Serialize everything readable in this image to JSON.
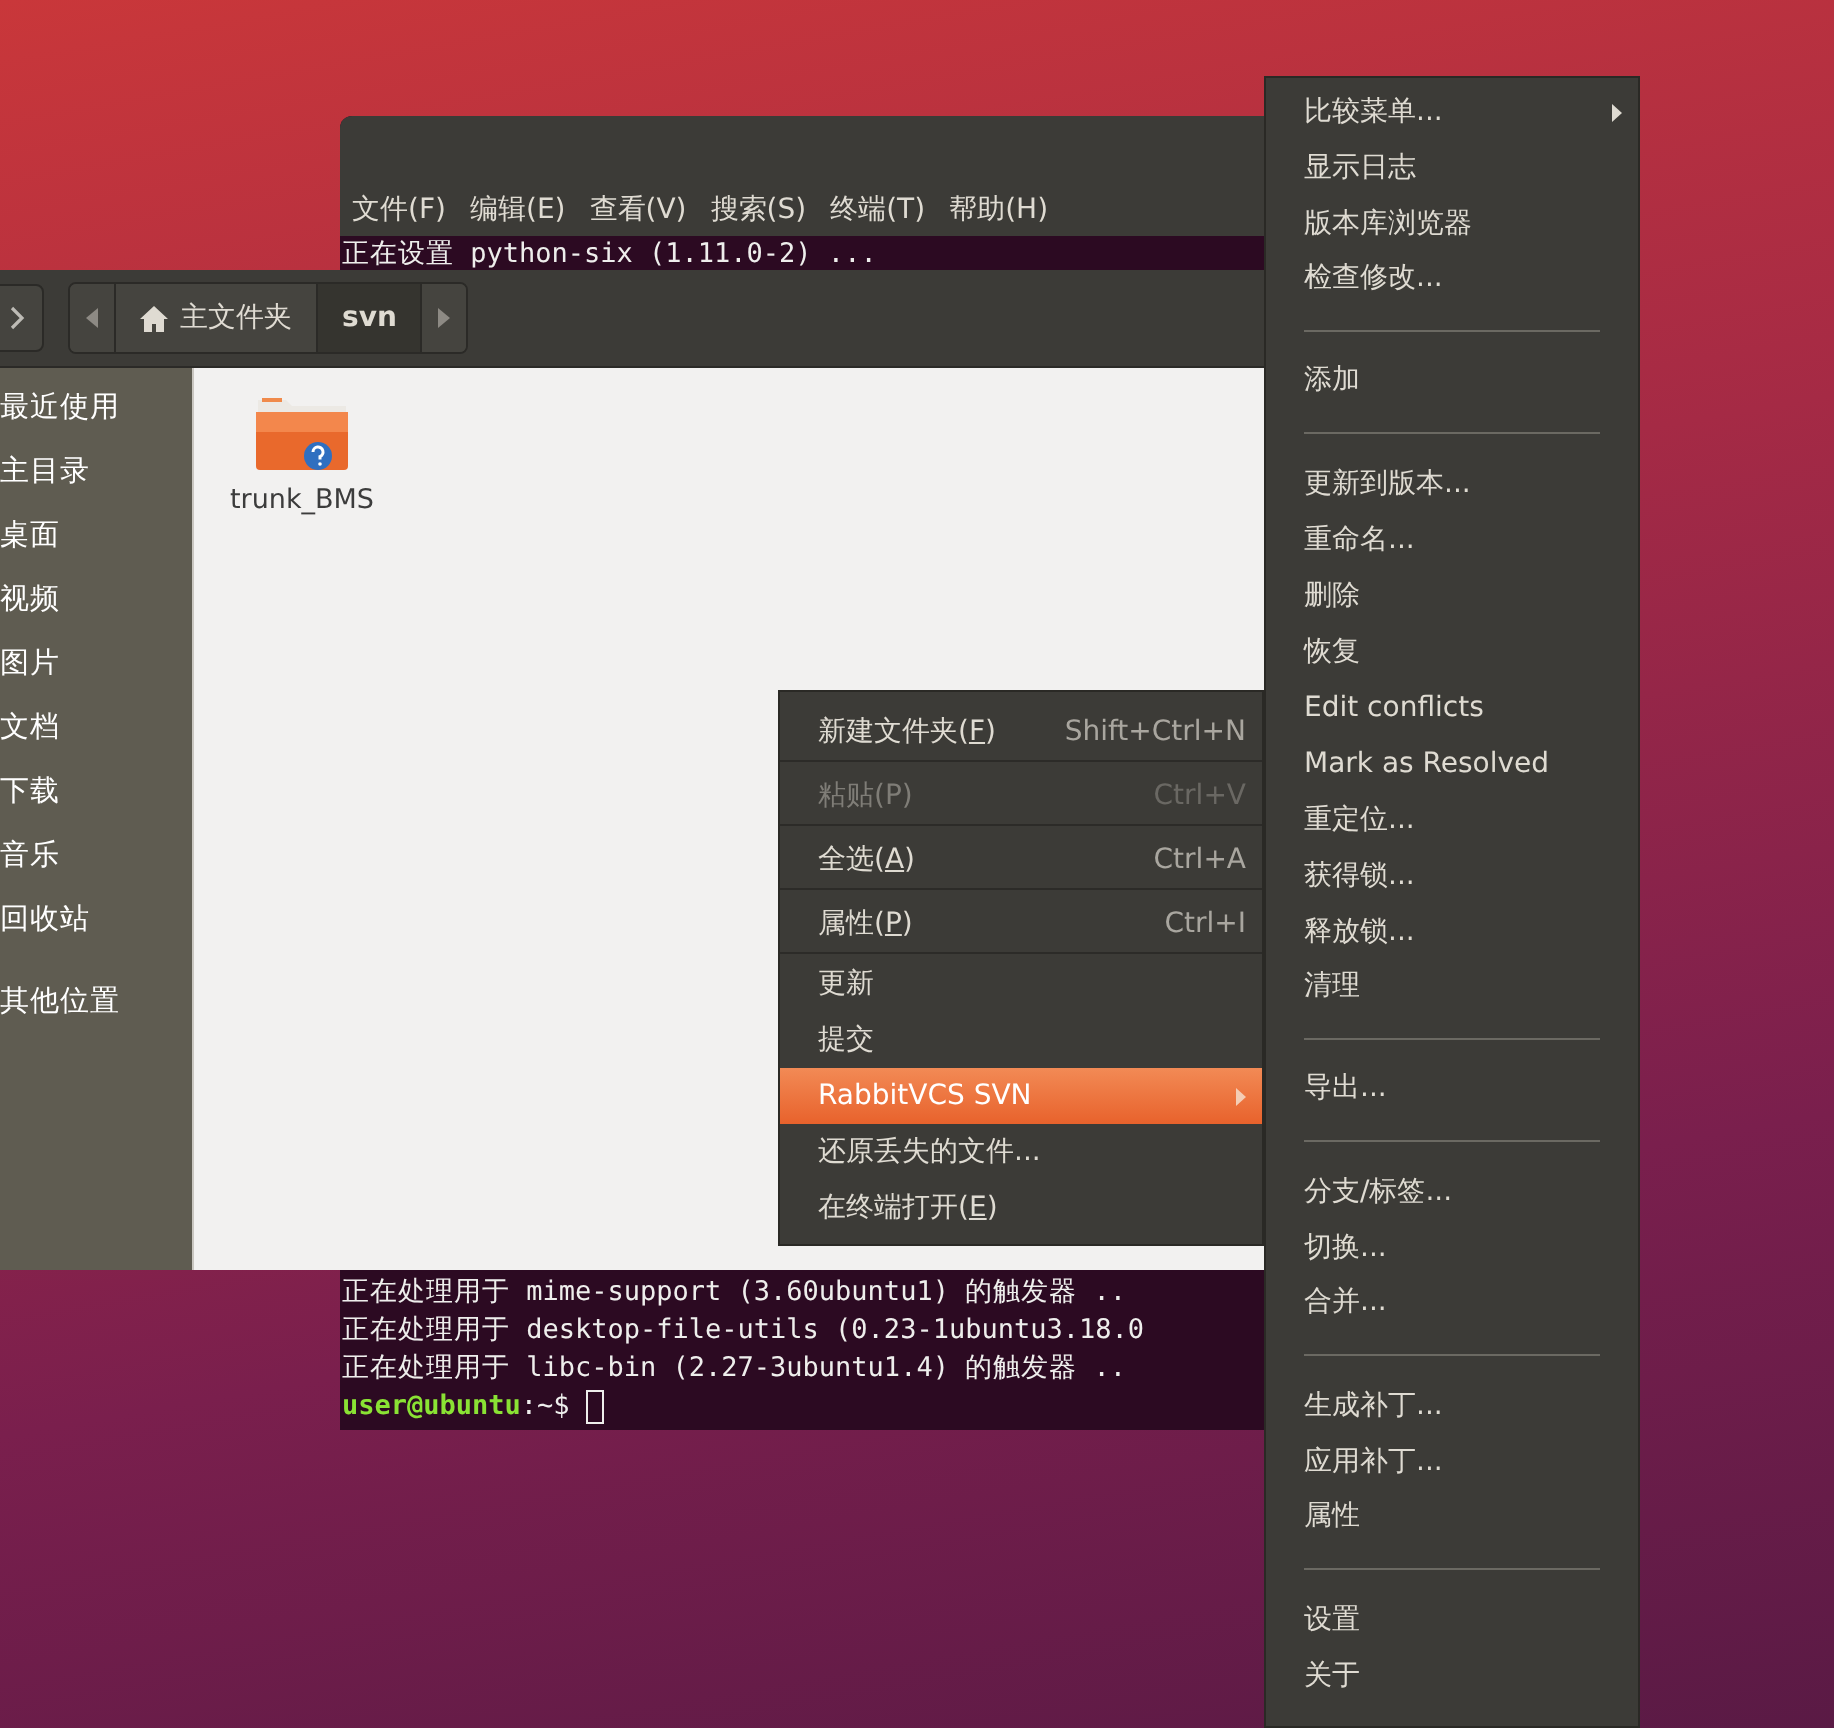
{
  "terminal": {
    "menu": [
      "文件(F)",
      "编辑(E)",
      "查看(V)",
      "搜索(S)",
      "终端(T)",
      "帮助(H)"
    ],
    "lines_top": [
      "正在设置 python-six (1.11.0-2) ..."
    ],
    "lines_bottom": [
      "正在处理用于 mime-support (3.60ubuntu1) 的触发器 ..",
      "正在处理用于 desktop-file-utils (0.23-1ubuntu3.18.0",
      "正在处理用于 libc-bin (2.27-3ubuntu1.4) 的触发器 .."
    ],
    "prompt": {
      "user": "user@ubuntu",
      "path": ":~$"
    }
  },
  "files": {
    "breadcrumb": [
      {
        "label": "主文件夹",
        "kind": "home",
        "selected": false
      },
      {
        "label": "svn",
        "kind": "folder",
        "selected": true
      }
    ],
    "sidebar": {
      "places": [
        "最近使用",
        "主目录",
        "桌面",
        "视频",
        "图片",
        "文档",
        "下载",
        "音乐",
        "回收站"
      ],
      "other": [
        "其他位置"
      ]
    },
    "items": [
      {
        "name": "trunk_BMS"
      }
    ]
  },
  "context_menu": {
    "items": [
      {
        "label": "新建文件夹(",
        "mnemonic": "F",
        "tail": ")",
        "shortcut": "Shift+Ctrl+N",
        "disabled": false,
        "selected": false,
        "submenu": false,
        "separator_after": true
      },
      {
        "label": "粘贴(P)",
        "shortcut": "Ctrl+V",
        "disabled": true,
        "selected": false,
        "submenu": false,
        "separator_after": true
      },
      {
        "label": "全选(",
        "mnemonic": "A",
        "tail": ")",
        "shortcut": "Ctrl+A",
        "disabled": false,
        "selected": false,
        "submenu": false,
        "separator_after": true
      },
      {
        "label": "属性(",
        "mnemonic": "P",
        "tail": ")",
        "shortcut": "Ctrl+I",
        "disabled": false,
        "selected": false,
        "submenu": false,
        "separator_after": true
      },
      {
        "label": "更新",
        "disabled": false,
        "selected": false,
        "submenu": false,
        "separator_after": false
      },
      {
        "label": "提交",
        "disabled": false,
        "selected": false,
        "submenu": false,
        "separator_after": false
      },
      {
        "label": "RabbitVCS SVN",
        "disabled": false,
        "selected": true,
        "submenu": true,
        "separator_after": false
      },
      {
        "label": "还原丢失的文件...",
        "disabled": false,
        "selected": false,
        "submenu": false,
        "separator_after": false
      },
      {
        "label": "在终端打开(",
        "mnemonic": "E",
        "tail": ")",
        "disabled": false,
        "selected": false,
        "submenu": false,
        "separator_after": false
      }
    ]
  },
  "rabbit_menu": {
    "items": [
      {
        "label": "比较菜单...",
        "submenu": true,
        "separator_after": false
      },
      {
        "label": "显示日志",
        "submenu": false,
        "separator_after": false
      },
      {
        "label": "版本库浏览器",
        "submenu": false,
        "separator_after": false
      },
      {
        "label": "检查修改...",
        "submenu": false,
        "separator_after": true
      },
      {
        "label": "添加",
        "submenu": false,
        "separator_after": true
      },
      {
        "label": "更新到版本...",
        "submenu": false,
        "separator_after": false
      },
      {
        "label": "重命名...",
        "submenu": false,
        "separator_after": false
      },
      {
        "label": "删除",
        "submenu": false,
        "separator_after": false
      },
      {
        "label": "恢复",
        "submenu": false,
        "separator_after": false
      },
      {
        "label": "Edit conflicts",
        "submenu": false,
        "separator_after": false
      },
      {
        "label": "Mark as Resolved",
        "submenu": false,
        "separator_after": false
      },
      {
        "label": "重定位...",
        "submenu": false,
        "separator_after": false
      },
      {
        "label": "获得锁...",
        "submenu": false,
        "separator_after": false
      },
      {
        "label": "释放锁...",
        "submenu": false,
        "separator_after": false
      },
      {
        "label": "清理",
        "submenu": false,
        "separator_after": true
      },
      {
        "label": "导出...",
        "submenu": false,
        "separator_after": true
      },
      {
        "label": "分支/标签...",
        "submenu": false,
        "separator_after": false
      },
      {
        "label": "切换...",
        "submenu": false,
        "separator_after": false
      },
      {
        "label": "合并...",
        "submenu": false,
        "separator_after": true
      },
      {
        "label": "生成补丁...",
        "submenu": false,
        "separator_after": false
      },
      {
        "label": "应用补丁...",
        "submenu": false,
        "separator_after": false
      },
      {
        "label": "属性",
        "submenu": false,
        "separator_after": true
      },
      {
        "label": "设置",
        "submenu": false,
        "separator_after": false
      },
      {
        "label": "关于",
        "submenu": false,
        "separator_after": false
      }
    ]
  }
}
